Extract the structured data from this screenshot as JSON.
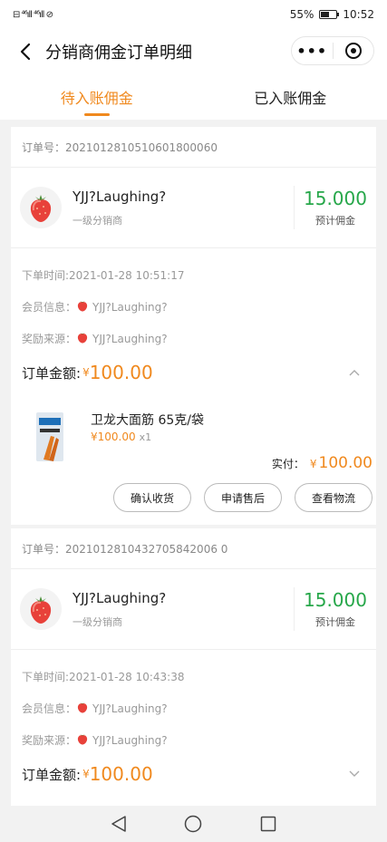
{
  "status_bar": {
    "left": "⊟ ⁴⁶ıll ⁴⁶ıll ⊘",
    "battery_text": "55%",
    "battery_level": 0.55,
    "time": "10:52"
  },
  "nav": {
    "title": "分销商佣金订单明细"
  },
  "tabs": [
    {
      "label": "待入账佣金",
      "active": true
    },
    {
      "label": "已入账佣金",
      "active": false
    }
  ],
  "orders": [
    {
      "order_no": "订单号：2021012810510601800060",
      "distributor_name": "YJJ?Laughing?",
      "distributor_level": "一级分销商",
      "commission_value": "15.000",
      "commission_label": "预计佣金",
      "order_time": "下单时间:2021-01-28 10:51:17",
      "member_label": "会员信息：",
      "member_name": "YJJ?Laughing?",
      "source_label": "奖励来源：",
      "source_name": "YJJ?Laughing?",
      "amount_label": "订单金额:",
      "currency": "¥",
      "amount": "100.00",
      "expanded": true,
      "product": {
        "name": "卫龙大面筋 65克/袋",
        "price": "¥100.00",
        "qty": "x1",
        "paid_label": "实付：",
        "paid_currency": "¥",
        "paid_amount": "100.00"
      },
      "actions": [
        "确认收货",
        "申请售后",
        "查看物流"
      ]
    },
    {
      "order_no": "订单号：2021012810432705842006 0",
      "distributor_name": "YJJ?Laughing?",
      "distributor_level": "一级分销商",
      "commission_value": "15.000",
      "commission_label": "预计佣金",
      "order_time": "下单时间:2021-01-28 10:43:38",
      "member_label": "会员信息：",
      "member_name": "YJJ?Laughing?",
      "source_label": "奖励来源：",
      "source_name": "YJJ?Laughing?",
      "amount_label": "订单金额:",
      "currency": "¥",
      "amount": "100.00",
      "expanded": false
    }
  ]
}
